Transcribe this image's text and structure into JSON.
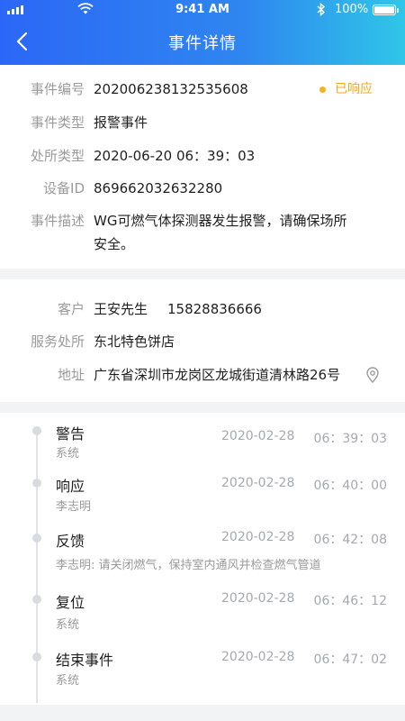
{
  "status_bar": {
    "time": "9:41 AM",
    "battery": "100%"
  },
  "header": {
    "title": "事件详情"
  },
  "event": {
    "id_label": "事件编号",
    "id_value": "202006238132535608",
    "status": "已响应",
    "type_label": "事件类型",
    "type_value": "报警事件",
    "handle_label": "处所类型",
    "handle_value": "2020-06-20 06：39：03",
    "device_label": "设备ID",
    "device_value": "869662032632280",
    "desc_label": "事件描述",
    "desc_line1": "WG可燃气体探测器发生报警，请确保场所",
    "desc_line2": "安全。"
  },
  "customer": {
    "client_label": "客户",
    "client_name": "王安先生",
    "client_phone": "15828836666",
    "venue_label": "服务处所",
    "venue_value": "东北特色饼店",
    "address_label": "地址",
    "address_value": "广东省深圳市龙岗区龙城街道清林路26号"
  },
  "timeline": [
    {
      "title": "警告",
      "sub": "系统",
      "date": "2020-02-28",
      "time": "06：39：03"
    },
    {
      "title": "响应",
      "sub": "李志明",
      "date": "2020-02-28",
      "time": "06：40：00"
    },
    {
      "title": "反馈",
      "sub": "李志明: 请关闭燃气，保持室内通风并检查燃气管道",
      "date": "2020-02-28",
      "time": "06：42：08"
    },
    {
      "title": "复位",
      "sub": "系统",
      "date": "2020-02-28",
      "time": "06：46：12"
    },
    {
      "title": "结束事件",
      "sub": "系统",
      "date": "2020-02-28",
      "time": "06：47：02"
    }
  ],
  "colors": {
    "header_start": "#2b67f6",
    "header_end": "#2fc6e8",
    "status": "#f2a91c"
  }
}
